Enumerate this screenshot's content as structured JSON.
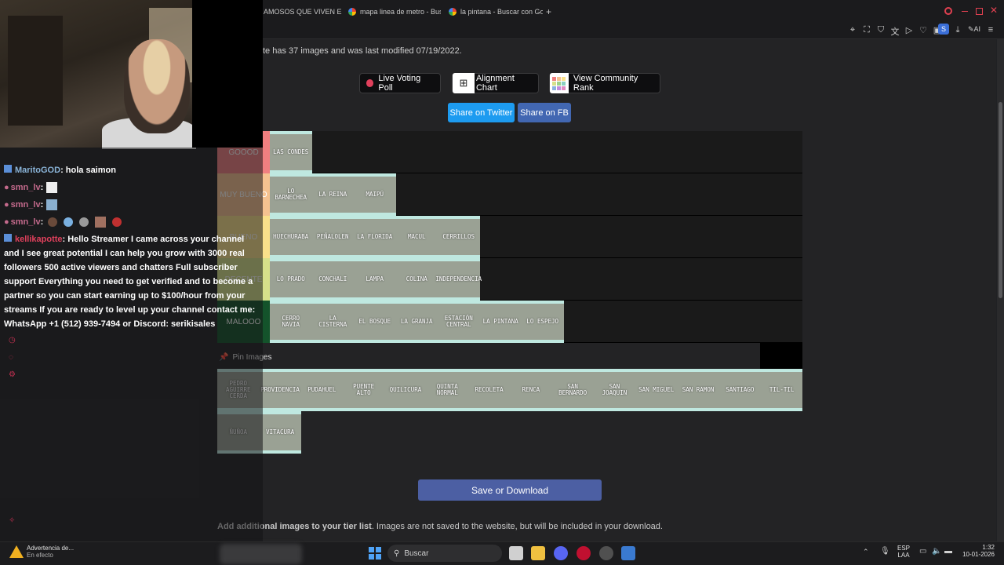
{
  "browser": {
    "tabs": [
      {
        "label": "AMOSOS QUE VIVEN EN"
      },
      {
        "label": "mapa linea de metro - Bus"
      },
      {
        "label": "la pintana - Buscar con Go"
      }
    ],
    "new_tab": "+",
    "profile_initial": "S",
    "ai_label": "AI"
  },
  "page": {
    "info_text": "te has 37 images and was last modified 07/19/2022.",
    "buttons": {
      "live_voting": "Live Voting Poll",
      "alignment_chart": "Alignment Chart",
      "community_rank": "View Community Rank",
      "share_twitter": "Share on Twitter",
      "share_fb": "Share on FB"
    },
    "tiers": [
      {
        "label": "GOOOD",
        "color": "#f07f80",
        "items": [
          "LAS CONDES"
        ]
      },
      {
        "label": "MUY BUENO",
        "color": "#f5c290",
        "items": [
          "LO BARNECHEA",
          "LA REINA",
          "MAIPÚ"
        ]
      },
      {
        "label": "BUENO",
        "color": "#f9e08a",
        "items": [
          "HUECHURABA",
          "PEÑALOLEN",
          "LA FLORIDA",
          "MACUL",
          "CERRILLOS"
        ]
      },
      {
        "label": "DECENTE",
        "color": "#d6e08a",
        "items": [
          "LO PRADO",
          "CONCHALI",
          "LAMPA",
          "COLINA",
          "INDEPENDENCIA"
        ]
      },
      {
        "label": "MALOOO",
        "color": "#14532b",
        "items": [
          "CERRO NAVIA",
          "LA CISTERNA",
          "EL BOSQUE",
          "LA GRANJA",
          "ESTACIÓN CENTRAL",
          "LA PINTANA",
          "LO ESPEJO"
        ]
      }
    ],
    "pin_label": "Pin Images",
    "pinned_items": [
      "PEDRO AGUIRRE CERDA",
      "PROVIDENCIA",
      "PUDAHUEL",
      "PUENTE ALTO",
      "QUILICURA",
      "QUINTA NORMAL",
      "RECOLETA",
      "RENCA",
      "SAN BERNARDO",
      "SAN JOAQUIN",
      "SAN MIGUEL",
      "SAN RAMON",
      "SANTIAGO",
      "TIL-TIL",
      "ÑUÑOA",
      "VITACURA"
    ],
    "save_button": "Save or Download",
    "add_images_bold": "Add additional images to your tier list",
    "add_images_rest": ". Images are not saved to the website, but will be included in your download."
  },
  "chat": {
    "messages": [
      {
        "user": "MaritoGOD",
        "text": ": hola saimon"
      },
      {
        "user": "smn_lv",
        "text": ":"
      },
      {
        "user": "smn_lv",
        "text": ":"
      },
      {
        "user": "smn_lv",
        "text": ":"
      }
    ],
    "spam_user": "kellikapotte",
    "spam_lines": [
      ": Hello Streamer I came across your channel",
      "and I see great potential I can help you grow with 3000 real",
      "followers 500 active viewers and chatters Full subscriber",
      "support Everything you need to get verified and to become a",
      "partner so you can start earning up to $100/hour from your",
      "streams If you are ready to level up your channel contact me:",
      "WhatsApp +1 (512) 939-7494 or Discord: serikisales"
    ]
  },
  "taskbar": {
    "notif_title": "Advertencia de...",
    "notif_sub": "En efecto",
    "search_placeholder": "Buscar",
    "lang_top": "ESP",
    "lang_bottom": "LAA",
    "time": "1:32",
    "date": "10-01-2026"
  }
}
